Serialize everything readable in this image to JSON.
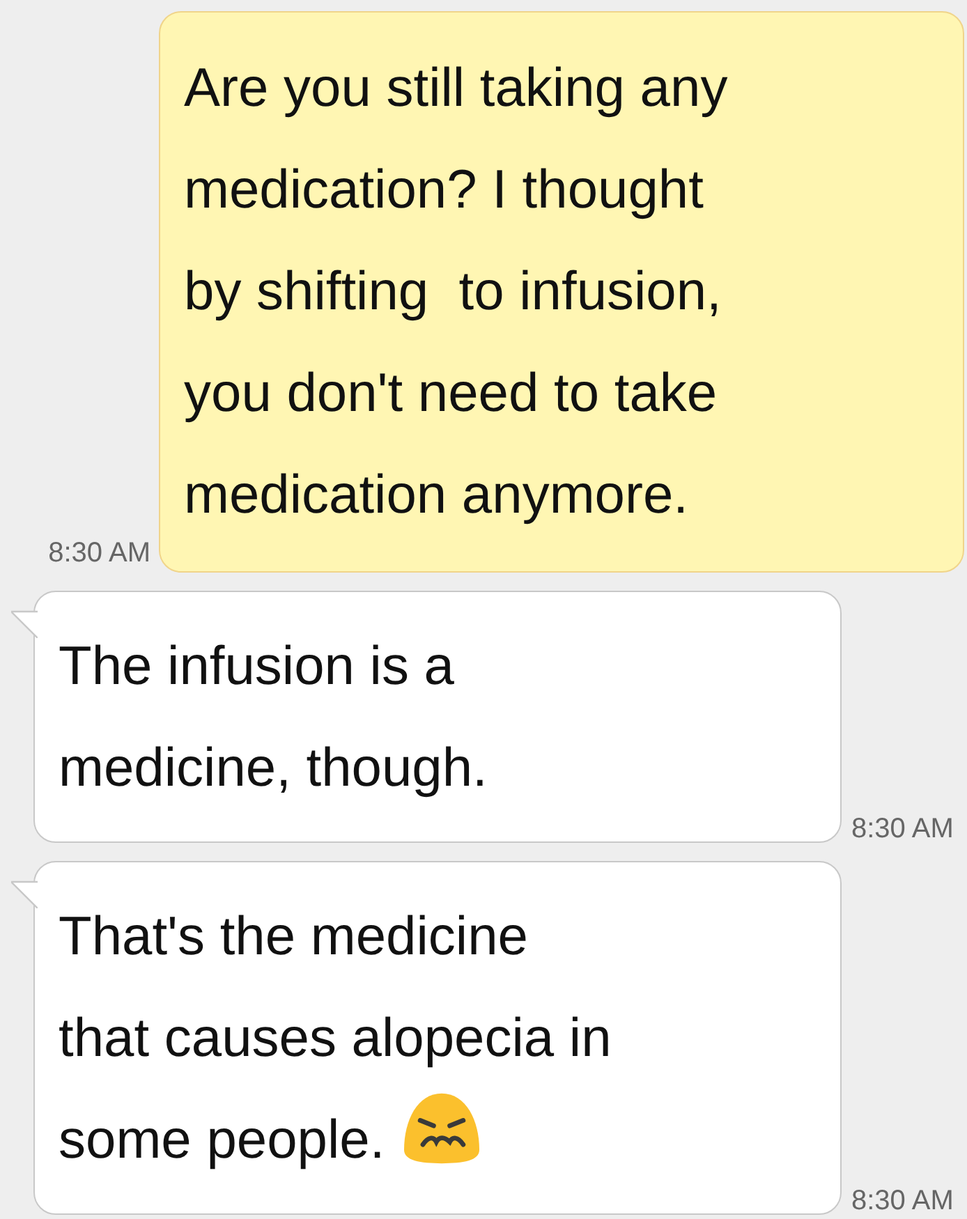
{
  "messages": [
    {
      "kind": "outgoing",
      "lines": [
        "Are you still taking any",
        "medication? I thought",
        "by shifting  to infusion,",
        "you don't need to take",
        "medication anymore."
      ],
      "time": "8:30 AM",
      "emoji": false
    },
    {
      "kind": "incoming",
      "lines": [
        "The infusion is a",
        "medicine, though."
      ],
      "time": "8:30 AM",
      "emoji": false
    },
    {
      "kind": "incoming",
      "lines": [
        "That's the medicine",
        "that causes alopecia in",
        "some people."
      ],
      "time": "8:30 AM",
      "emoji": true
    }
  ]
}
